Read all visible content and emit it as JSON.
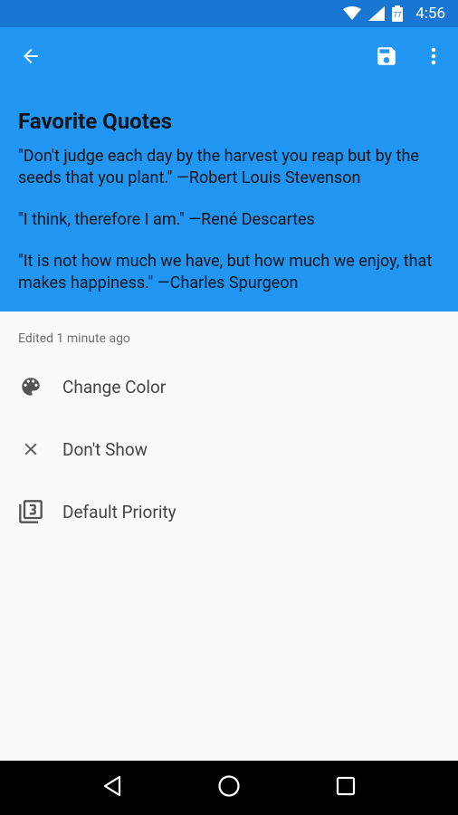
{
  "status_bar": {
    "time": "4:56",
    "icons": [
      "wifi-icon",
      "signal-icon",
      "battery-icon"
    ]
  },
  "toolbar": {
    "back_icon": "arrow-left-icon",
    "save_icon": "save-icon",
    "more_icon": "more-vert-icon"
  },
  "note": {
    "title": "Favorite Quotes",
    "paragraphs": [
      "\"Don't judge each day by the harvest you reap but by the seeds that you plant.\" —Robert Louis Stevenson",
      "\"I think, therefore I am.\" —René Descartes",
      "\"It is not how much we have, but how much we enjoy, that makes happiness.\" —Charles Spurgeon"
    ]
  },
  "sheet": {
    "edited": "Edited 1 minute ago",
    "items": [
      {
        "label": "Change Color",
        "icon": "palette-icon"
      },
      {
        "label": "Don't Show",
        "icon": "close-icon"
      },
      {
        "label": "Default Priority",
        "icon": "priority-3-icon"
      }
    ]
  },
  "colors": {
    "header": "#2196f3",
    "status_bar": "#1976d2",
    "sheet": "#fafafa",
    "nav_bar": "#000000"
  }
}
